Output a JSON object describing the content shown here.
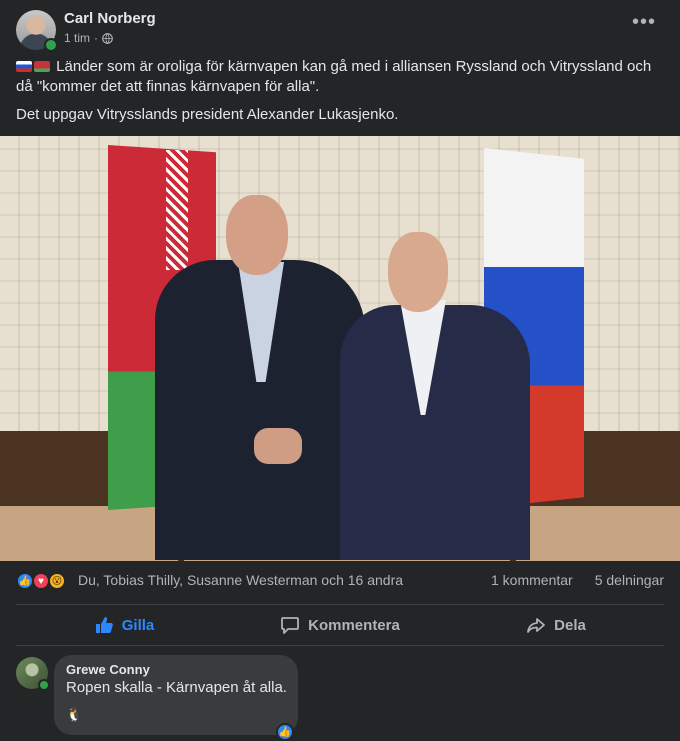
{
  "post": {
    "author": "Carl Norberg",
    "time": "1 tim",
    "separator": "·",
    "text_line1": "Länder som är oroliga för kärnvapen kan gå med i alliansen Ryssland och Vitryssland och då \"kommer det att finnas kärnvapen för alla\".",
    "text_line2": "Det uppgav Vitrysslands president Alexander Lukasjenko.",
    "more_label": "•••",
    "flags": [
      "russia-flag",
      "belarus-flag"
    ]
  },
  "reactions": {
    "icons": [
      "like-icon",
      "love-icon",
      "wow-icon"
    ],
    "names": "Du, Tobias Thilly, Susanne Westerman och 16 andra",
    "comments": "1 kommentar",
    "shares": "5 delningar"
  },
  "actions": {
    "like": "Gilla",
    "comment": "Kommentera",
    "share": "Dela"
  },
  "comment": {
    "author": "Grewe Conny",
    "text": "Ropen skalla - Kärnvapen åt alla.",
    "emoji": "🐧",
    "badge": "👍"
  },
  "colors": {
    "background": "#242526",
    "accent": "#2d88ff",
    "online": "#31a24c",
    "bubble": "#3a3b3c"
  }
}
